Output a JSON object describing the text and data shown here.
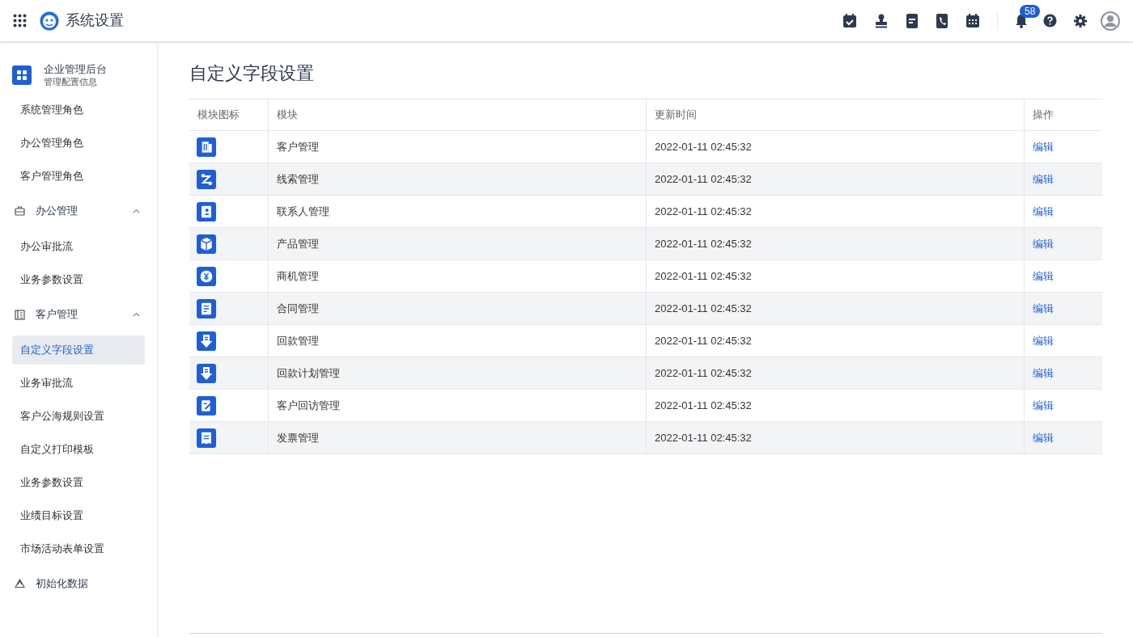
{
  "app_bar": {
    "title": "系统设置",
    "notification_count": "58"
  },
  "sidebar": {
    "header": {
      "title": "企业管理后台",
      "subtitle": "管理配置信息"
    },
    "items": [
      {
        "kind": "link",
        "label": "系统管理角色",
        "selected": false
      },
      {
        "kind": "link",
        "label": "办公管理角色",
        "selected": false
      },
      {
        "kind": "link",
        "label": "客户管理角色",
        "selected": false
      },
      {
        "kind": "group",
        "label": "办公管理",
        "expanded": true,
        "children": [
          {
            "label": "办公审批流",
            "selected": false
          },
          {
            "label": "业务参数设置",
            "selected": false
          }
        ]
      },
      {
        "kind": "group",
        "label": "客户管理",
        "expanded": true,
        "children": [
          {
            "label": "自定义字段设置",
            "selected": true
          },
          {
            "label": "业务审批流",
            "selected": false
          },
          {
            "label": "客户公海规则设置",
            "selected": false
          },
          {
            "label": "自定义打印模板",
            "selected": false
          },
          {
            "label": "业务参数设置",
            "selected": false
          },
          {
            "label": "业绩目标设置",
            "selected": false
          },
          {
            "label": "市场活动表单设置",
            "selected": false
          }
        ]
      },
      {
        "kind": "action",
        "label": "初始化数据",
        "selected": false
      }
    ]
  },
  "page_title": "自定义字段设置",
  "table": {
    "columns": [
      "模块图标",
      "模块",
      "更新时间",
      "操作"
    ],
    "rows": [
      {
        "module": "客户管理",
        "updated": "2022-01-11 02:45:32",
        "action": "编辑"
      },
      {
        "module": "线索管理",
        "updated": "2022-01-11 02:45:32",
        "action": "编辑"
      },
      {
        "module": "联系人管理",
        "updated": "2022-01-11 02:45:32",
        "action": "编辑"
      },
      {
        "module": "产品管理",
        "updated": "2022-01-11 02:45:32",
        "action": "编辑"
      },
      {
        "module": "商机管理",
        "updated": "2022-01-11 02:45:32",
        "action": "编辑"
      },
      {
        "module": "合同管理",
        "updated": "2022-01-11 02:45:32",
        "action": "编辑"
      },
      {
        "module": "回款管理",
        "updated": "2022-01-11 02:45:32",
        "action": "编辑"
      },
      {
        "module": "回款计划管理",
        "updated": "2022-01-11 02:45:32",
        "action": "编辑"
      },
      {
        "module": "客户回访管理",
        "updated": "2022-01-11 02:45:32",
        "action": "编辑"
      },
      {
        "module": "发票管理",
        "updated": "2022-01-11 02:45:32",
        "action": "编辑"
      }
    ]
  }
}
